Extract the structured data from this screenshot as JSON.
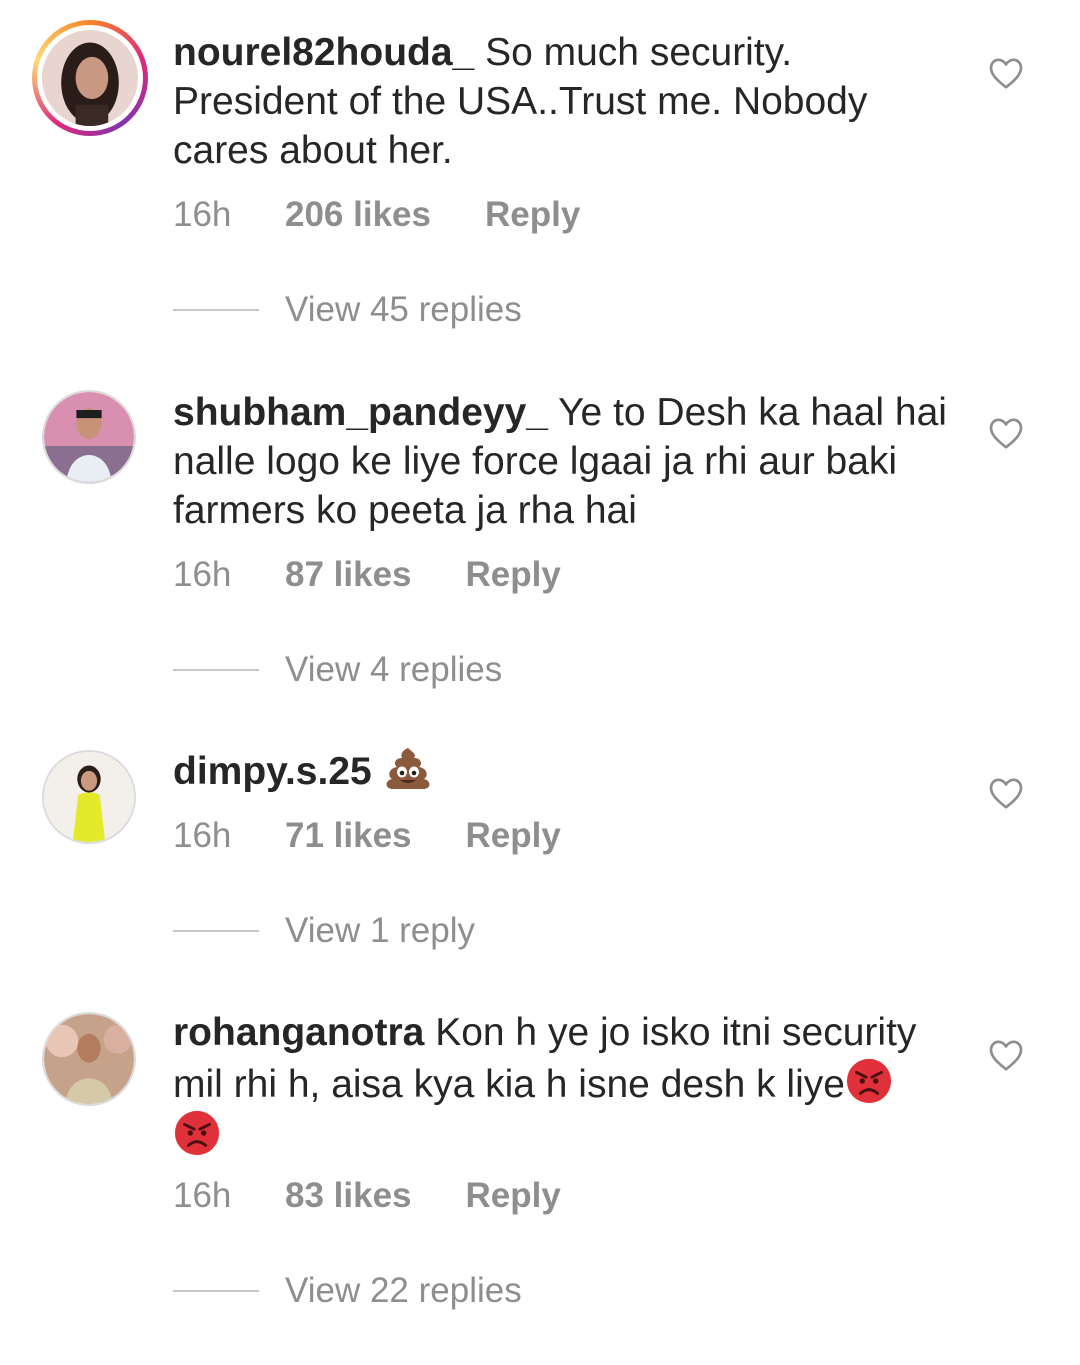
{
  "comments": [
    {
      "username": "nourel82houda_",
      "text": "So much security. President of the USA..Trust me. Nobody cares about her.",
      "time": "16h",
      "likes": "206 likes",
      "reply": "Reply",
      "view_replies": "View 45 replies"
    },
    {
      "username": "shubham_pandeyy_",
      "text": "Ye to Desh ka haal hai nalle logo ke liye force lgaai ja rhi aur baki farmers ko peeta ja rha hai",
      "time": "16h",
      "likes": "87 likes",
      "reply": "Reply",
      "view_replies": "View 4 replies"
    },
    {
      "username": "dimpy.s.25",
      "text": "",
      "emoji": "poop-emoji",
      "time": "16h",
      "likes": "71 likes",
      "reply": "Reply",
      "view_replies": "View 1 reply"
    },
    {
      "username": "rohanganotra",
      "text": "Kon h ye jo isko itni security mil rhi h, aisa kya kia h isne desh k liye",
      "emoji": "angry-face-emoji",
      "time": "16h",
      "likes": "83 likes",
      "reply": "Reply",
      "view_replies": "View 22 replies"
    }
  ],
  "icons": {
    "like": "heart-outline-icon"
  },
  "colors": {
    "text": "#262626",
    "muted": "#8e8e8e",
    "divider": "#c7c7c7"
  }
}
